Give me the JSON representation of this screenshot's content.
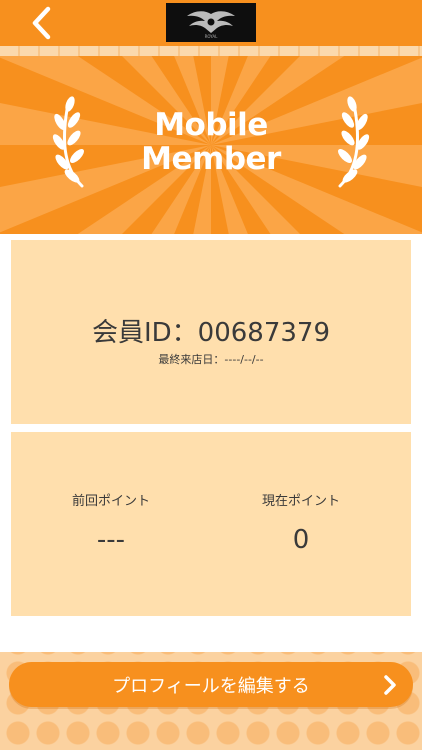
{
  "header": {
    "back_icon": "chevron-left-icon",
    "logo_text": "ROYAL"
  },
  "banner": {
    "title_line1": "Mobile",
    "title_line2": "Member",
    "laurel_icon": "laurel-icon"
  },
  "member": {
    "id_text": "会員ID：00687379",
    "last_visit": "最終来店日：----/--/--"
  },
  "points": {
    "previous_label": "前回ポイント",
    "previous_value": "---",
    "current_label": "現在ポイント",
    "current_value": "0"
  },
  "actions": {
    "edit_profile_label": "プロフィールを編集する",
    "edit_icon": "chevron-right-icon"
  },
  "colors": {
    "accent": "#f7901e",
    "card": "#ffdfad",
    "text": "#3a3a3a"
  }
}
